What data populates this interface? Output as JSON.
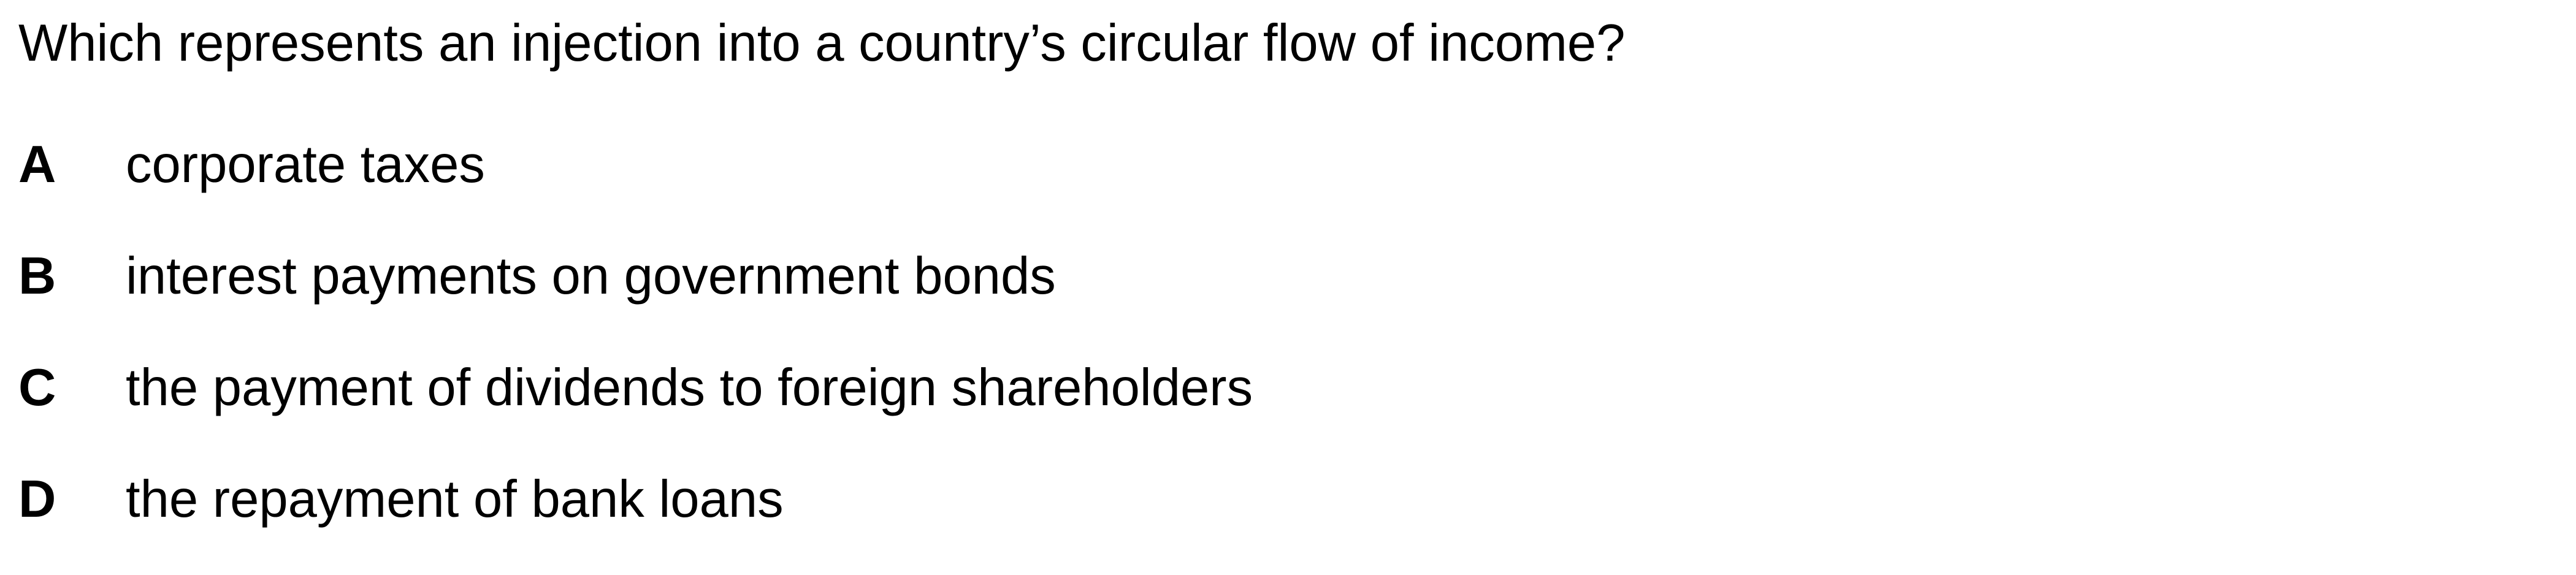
{
  "question": {
    "text": "Which represents an injection into a country’s circular flow of income?"
  },
  "options": [
    {
      "letter": "A",
      "text": "corporate taxes"
    },
    {
      "letter": "B",
      "text": "interest payments on government bonds"
    },
    {
      "letter": "C",
      "text": "the payment of dividends to foreign shareholders"
    },
    {
      "letter": "D",
      "text": "the repayment of bank loans"
    }
  ]
}
